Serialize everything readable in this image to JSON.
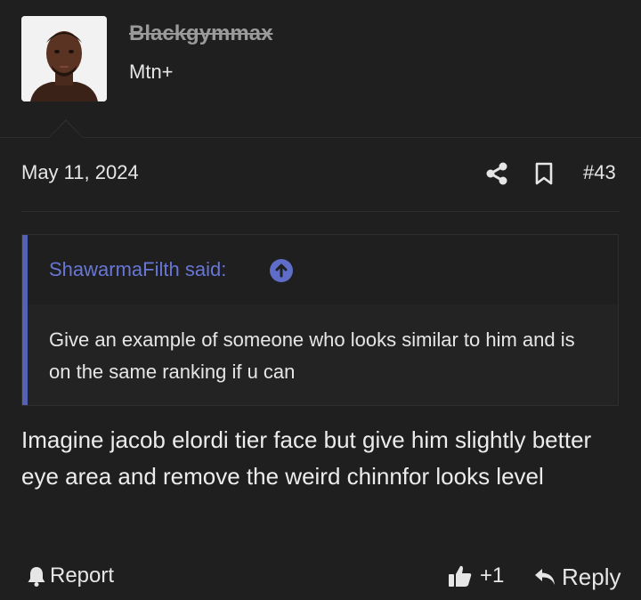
{
  "user": {
    "username": "Blackgymmax",
    "title": "Mtn+"
  },
  "meta": {
    "date": "May 11, 2024",
    "post_number": "#43"
  },
  "quote": {
    "author": "ShawarmaFilth said:",
    "text": "Give an example of someone who looks similar to him and is on the same ranking if u can"
  },
  "post": {
    "body": "Imagine jacob elordi tier face but give him slightly better eye area and remove the weird chinnfor looks level"
  },
  "actions": {
    "report_label": "Report",
    "like_count": "+1",
    "reply_label": "Reply"
  },
  "icons": {
    "share": "share-icon",
    "bookmark": "bookmark-icon",
    "quote_jump": "arrow-up-circle-icon",
    "report": "bell-icon",
    "like": "thumbs-up-icon",
    "reply": "reply-icon"
  },
  "colors": {
    "background": "#1f1f1f",
    "quote_accent": "#5561b4",
    "quote_author": "#6876d6",
    "text": "#e6e6e6"
  }
}
